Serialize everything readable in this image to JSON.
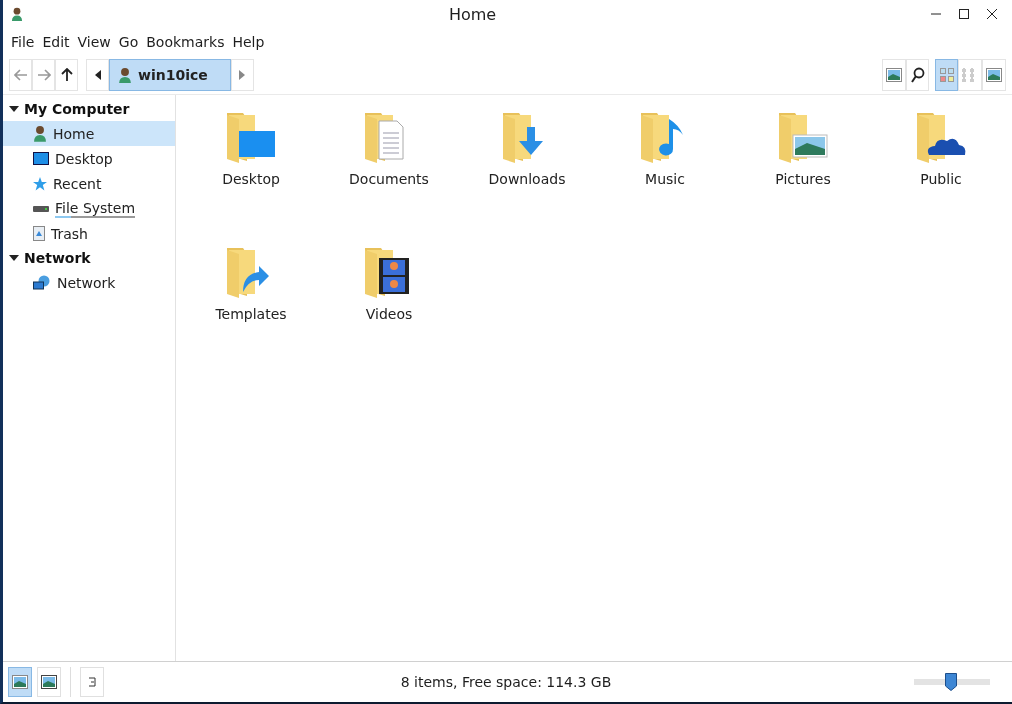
{
  "window": {
    "title": "Home"
  },
  "menu": [
    "File",
    "Edit",
    "View",
    "Go",
    "Bookmarks",
    "Help"
  ],
  "breadcrumb": {
    "label": "win10ice",
    "selected": true
  },
  "view_modes": [
    {
      "kind": "icons",
      "selected": true
    },
    {
      "kind": "compact",
      "selected": false
    },
    {
      "kind": "preview",
      "selected": false
    }
  ],
  "sidebar": {
    "sections": [
      {
        "label": "My Computer",
        "expanded": true,
        "children": [
          {
            "label": "Home",
            "kind": "home",
            "selected": true
          },
          {
            "label": "Desktop",
            "kind": "desktop",
            "selected": false
          },
          {
            "label": "Recent",
            "kind": "recent",
            "selected": false
          },
          {
            "label": "File System",
            "kind": "drive",
            "selected": false,
            "level": 0.2
          },
          {
            "label": "Trash",
            "kind": "trash",
            "selected": false
          }
        ]
      },
      {
        "label": "Network",
        "expanded": true,
        "children": [
          {
            "label": "Network",
            "kind": "network",
            "selected": false
          }
        ]
      }
    ]
  },
  "files": [
    {
      "name": "Desktop",
      "kind": "desktop"
    },
    {
      "name": "Documents",
      "kind": "documents"
    },
    {
      "name": "Downloads",
      "kind": "downloads"
    },
    {
      "name": "Music",
      "kind": "music"
    },
    {
      "name": "Pictures",
      "kind": "pictures"
    },
    {
      "name": "Public",
      "kind": "public"
    },
    {
      "name": "Templates",
      "kind": "templates"
    },
    {
      "name": "Videos",
      "kind": "videos"
    }
  ],
  "status_bar": {
    "panes": [
      {
        "kind": "places",
        "selected": true
      },
      {
        "kind": "tree",
        "selected": false
      }
    ],
    "text": "8 items, Free space: 114.3 GB",
    "zoom": {
      "level": 0.49
    }
  }
}
